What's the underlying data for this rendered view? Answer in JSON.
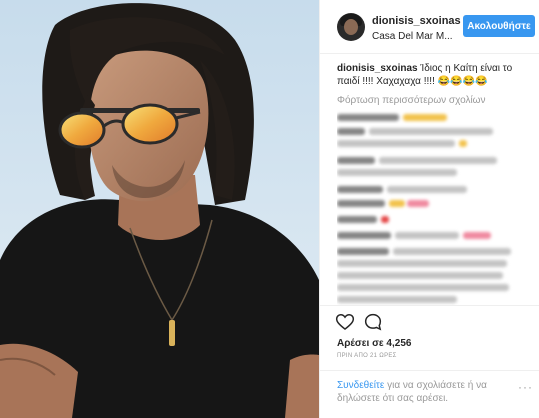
{
  "post": {
    "username": "dionisis_sxoinas",
    "location": "Casa Del Mar M...",
    "follow_label": "Ακολουθήστε",
    "caption_user": "dionisis_sxoinas",
    "caption_text": " Ίδιος η Καίτη είναι το παιδί !!!! Χαχαχαχα !!!! 😂😂😂😂",
    "load_more_label": "Φόρτωση περισσότερων σχολίων",
    "likes_label": "Αρέσει σε 4,256",
    "timestamp": "ΠΡΙΝ ΑΠΟ 21 ΩΡΕΣ",
    "footer_login_link": "Συνδεθείτε",
    "footer_text": " για να σχολιάσετε ή να δηλώσετε ότι σας αρέσει.",
    "more_icon": "···"
  },
  "colors": {
    "accent": "#3897f0",
    "text": "#262626",
    "muted": "#999999",
    "border": "#efefef"
  },
  "icons": {
    "like": "heart-outline-icon",
    "comment": "speech-bubble-icon",
    "more": "ellipsis-icon"
  }
}
